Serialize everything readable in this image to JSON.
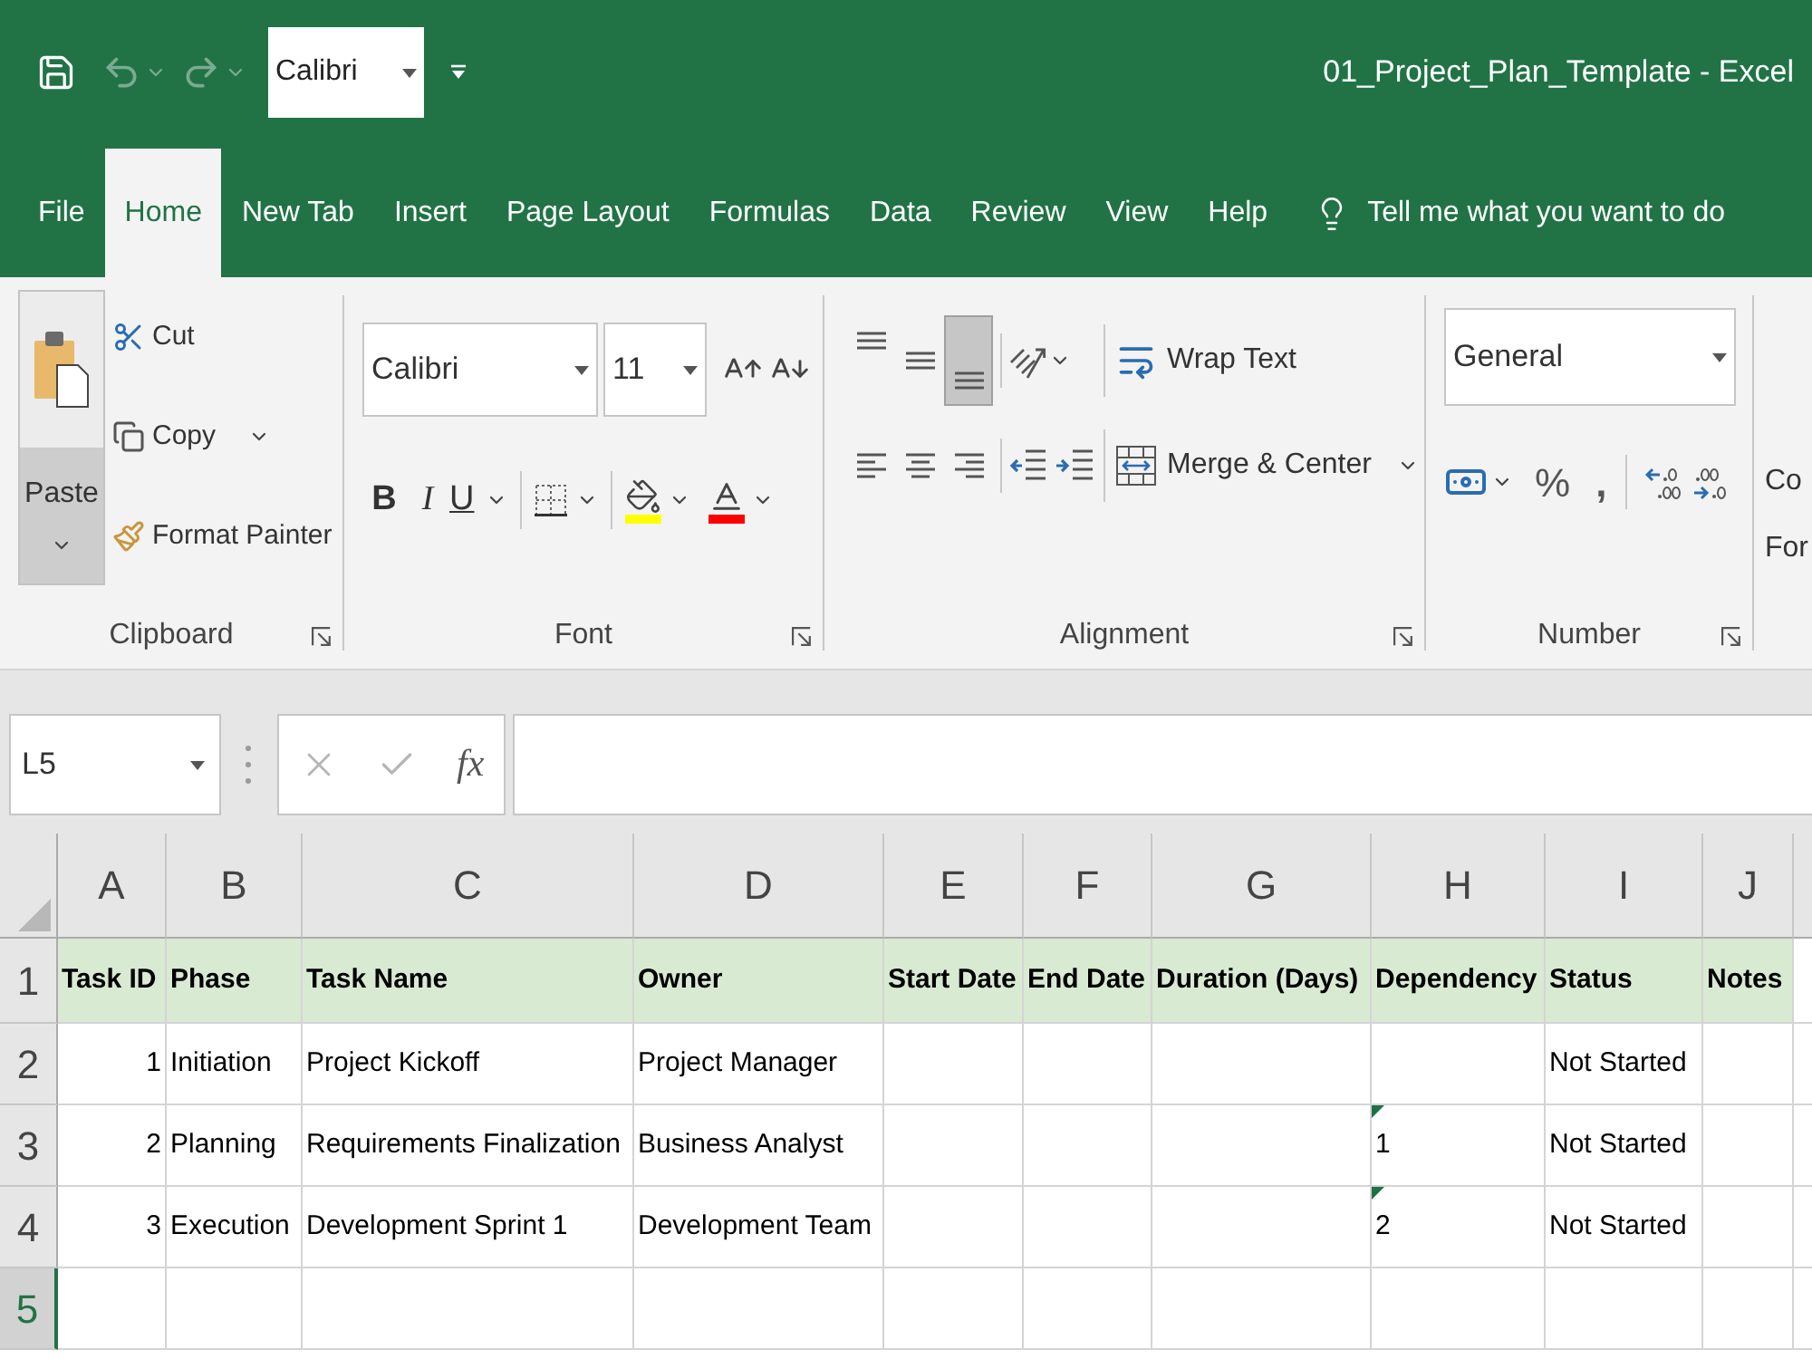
{
  "quick_access": {
    "undo": {
      "disabled": true
    },
    "redo": {
      "disabled": true
    },
    "font": "Calibri"
  },
  "window": {
    "title": "01_Project_Plan_Template - Excel"
  },
  "tabs": [
    {
      "label": "File",
      "selected": false
    },
    {
      "label": "Home",
      "selected": true
    },
    {
      "label": "New Tab",
      "selected": false
    },
    {
      "label": "Insert",
      "selected": false
    },
    {
      "label": "Page Layout",
      "selected": false
    },
    {
      "label": "Formulas",
      "selected": false
    },
    {
      "label": "Data",
      "selected": false
    },
    {
      "label": "Review",
      "selected": false
    },
    {
      "label": "View",
      "selected": false
    },
    {
      "label": "Help",
      "selected": false
    }
  ],
  "tell_me": "Tell me what you want to do",
  "clipboard": {
    "label": "Clipboard",
    "paste": "Paste",
    "cut": "Cut",
    "copy": "Copy",
    "format_painter": "Format Painter"
  },
  "font": {
    "label": "Font",
    "font_name": "Calibri",
    "font_size": "11",
    "bold": "B",
    "italic": "I",
    "underline": "U"
  },
  "alignment": {
    "label": "Alignment",
    "vertical": [
      {
        "kind": "top",
        "selected": false
      },
      {
        "kind": "middle",
        "selected": false
      },
      {
        "kind": "bottom",
        "selected": true
      }
    ],
    "horizontal": [
      {
        "kind": "left",
        "selected": false
      },
      {
        "kind": "center",
        "selected": false
      },
      {
        "kind": "right",
        "selected": false
      }
    ],
    "wrap_text": "Wrap Text",
    "merge_center": "Merge & Center"
  },
  "number": {
    "label": "Number",
    "format": "General",
    "percent": "%",
    "comma": ","
  },
  "cut_off_group": {
    "lines": [
      "Co",
      "For"
    ]
  },
  "formula_bar": {
    "name_box": "L5",
    "function": "fx"
  },
  "sheet": {
    "columns": [
      {
        "label": "A",
        "selected": false
      },
      {
        "label": "B",
        "selected": false
      },
      {
        "label": "C",
        "selected": false
      },
      {
        "label": "D",
        "selected": false
      },
      {
        "label": "E",
        "selected": false
      },
      {
        "label": "F",
        "selected": false
      },
      {
        "label": "G",
        "selected": false
      },
      {
        "label": "H",
        "selected": false
      },
      {
        "label": "I",
        "selected": false
      },
      {
        "label": "J",
        "selected": false
      }
    ],
    "rows": [
      {
        "label": "1",
        "kind": "header",
        "selected": false,
        "cells": [
          {
            "text": "Task ID",
            "error_indicator": false
          },
          {
            "text": "Phase",
            "error_indicator": false
          },
          {
            "text": "Task Name",
            "error_indicator": false
          },
          {
            "text": "Owner",
            "error_indicator": false
          },
          {
            "text": "Start Date",
            "error_indicator": false
          },
          {
            "text": "End Date",
            "error_indicator": false
          },
          {
            "text": "Duration (Days)",
            "error_indicator": false
          },
          {
            "text": "Dependency",
            "error_indicator": false
          },
          {
            "text": "Status",
            "error_indicator": false
          },
          {
            "text": "Notes",
            "error_indicator": false
          }
        ]
      },
      {
        "label": "2",
        "kind": "data",
        "selected": false,
        "cells": [
          {
            "text": "1",
            "error_indicator": false
          },
          {
            "text": "Initiation",
            "error_indicator": false
          },
          {
            "text": "Project Kickoff",
            "error_indicator": false
          },
          {
            "text": "Project Manager",
            "error_indicator": false
          },
          {
            "error_indicator": false
          },
          {
            "error_indicator": false
          },
          {
            "error_indicator": false
          },
          {
            "error_indicator": false
          },
          {
            "text": "Not Started",
            "error_indicator": false
          }
        ]
      },
      {
        "label": "3",
        "kind": "data",
        "selected": false,
        "cells": [
          {
            "text": "2",
            "error_indicator": false
          },
          {
            "text": "Planning",
            "error_indicator": false
          },
          {
            "text": "Requirements Finalization",
            "error_indicator": false
          },
          {
            "text": "Business Analyst",
            "error_indicator": false
          },
          {
            "error_indicator": false
          },
          {
            "error_indicator": false
          },
          {
            "error_indicator": false
          },
          {
            "text": "1",
            "error_indicator": true
          },
          {
            "text": "Not Started",
            "error_indicator": false
          }
        ]
      },
      {
        "label": "4",
        "kind": "data",
        "selected": false,
        "cells": [
          {
            "text": "3",
            "error_indicator": false
          },
          {
            "text": "Execution",
            "error_indicator": false
          },
          {
            "text": "Development Sprint 1",
            "error_indicator": false
          },
          {
            "text": "Development Team",
            "error_indicator": false
          },
          {
            "error_indicator": false
          },
          {
            "error_indicator": false
          },
          {
            "error_indicator": false
          },
          {
            "text": "2",
            "error_indicator": true
          },
          {
            "text": "Not Started",
            "error_indicator": false
          }
        ]
      },
      {
        "label": "5",
        "kind": "data",
        "selected": true
      }
    ]
  }
}
